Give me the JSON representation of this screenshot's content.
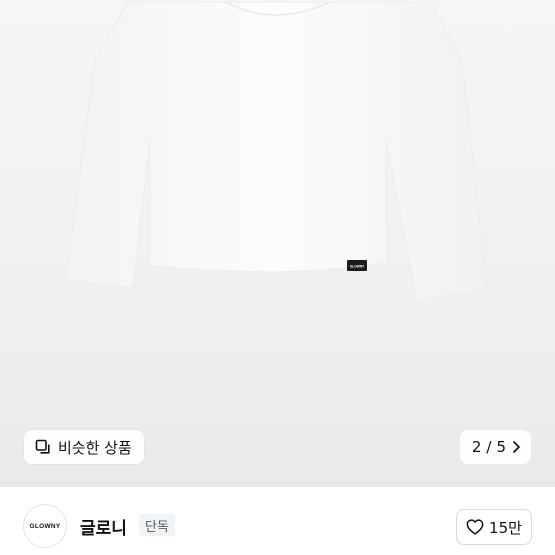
{
  "product": {
    "image_alt": "white long sleeve top",
    "label_text": "GLOWNY"
  },
  "overlay": {
    "similar_label": "비슷한 상품",
    "pager_current": "2",
    "pager_separator": "/",
    "pager_total": "5"
  },
  "shop": {
    "logo_text": "GLOWNY",
    "name": "글로니",
    "tag": "단독"
  },
  "like": {
    "count": "15만"
  },
  "colors": {
    "garment": "#fbfbf9",
    "background": "#f0f0f0",
    "tag_bg": "#f2f3f5",
    "tag_text": "#4c5a6e"
  }
}
